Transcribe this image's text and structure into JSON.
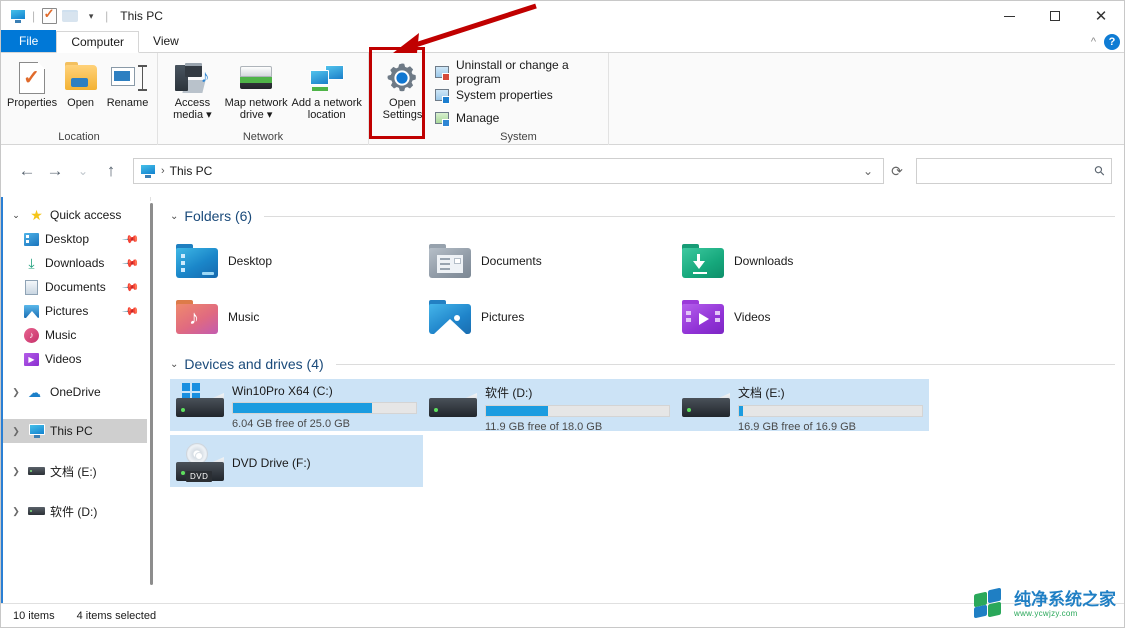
{
  "window": {
    "title": "This PC",
    "quick_access_toolbar": [
      {
        "name": "this-pc-icon",
        "label": "This PC"
      },
      {
        "name": "properties-icon",
        "label": "Properties"
      },
      {
        "name": "new-folder-icon",
        "label": "New folder"
      },
      {
        "name": "customize-caret-icon",
        "label": "Customize Quick Access Toolbar"
      }
    ],
    "controls": {
      "minimize": "—",
      "maximize": "□",
      "close": "✕"
    }
  },
  "tabs": [
    {
      "label": "File",
      "state": "file"
    },
    {
      "label": "Computer",
      "state": "active"
    },
    {
      "label": "View",
      "state": "normal"
    }
  ],
  "ribbon": {
    "collapse_label": "^",
    "help_label": "?",
    "groups": [
      {
        "name": "Location",
        "buttons": [
          {
            "label": "Properties",
            "icon": "properties-icon",
            "split": false
          },
          {
            "label": "Open",
            "icon": "open-folder-icon",
            "split": false
          },
          {
            "label": "Rename",
            "icon": "rename-icon",
            "split": false
          }
        ]
      },
      {
        "name": "Network",
        "buttons": [
          {
            "label": "Access media",
            "icon": "access-media-icon",
            "split": true
          },
          {
            "label": "Map network drive",
            "icon": "map-network-drive-icon",
            "split": true
          },
          {
            "label": "Add a network location",
            "icon": "add-network-location-icon",
            "split": false
          }
        ]
      },
      {
        "name": "System",
        "buttons": [
          {
            "label": "Open Settings",
            "icon": "settings-gear-icon",
            "split": false
          }
        ],
        "commands": [
          {
            "label": "Uninstall or change a program",
            "icon": "uninstall-program-icon"
          },
          {
            "label": "System properties",
            "icon": "system-properties-icon"
          },
          {
            "label": "Manage",
            "icon": "manage-icon"
          }
        ]
      }
    ],
    "highlight": {
      "target": "Open Settings",
      "color": "#c00000",
      "annotation": "red-arrow"
    }
  },
  "addressbar": {
    "back_label": "←",
    "forward_label": "→",
    "recent_label": "⌄",
    "up_label": "↑",
    "breadcrumbs": [
      "This PC"
    ],
    "separator": "›",
    "dropdown_label": "⌄",
    "refresh_label": "⟳",
    "search_value": "",
    "search_placeholder": "",
    "search_icon": "search-icon"
  },
  "navpane": {
    "items": [
      {
        "label": "Quick access",
        "icon": "star-icon",
        "chevron": "open",
        "indent": 0,
        "pinned": false,
        "selected": false
      },
      {
        "label": "Desktop",
        "icon": "desktop-icon",
        "chevron": "none",
        "indent": 1,
        "pinned": true,
        "selected": false
      },
      {
        "label": "Downloads",
        "icon": "downloads-icon",
        "chevron": "none",
        "indent": 1,
        "pinned": true,
        "selected": false
      },
      {
        "label": "Documents",
        "icon": "documents-icon",
        "chevron": "none",
        "indent": 1,
        "pinned": true,
        "selected": false
      },
      {
        "label": "Pictures",
        "icon": "pictures-icon",
        "chevron": "none",
        "indent": 1,
        "pinned": true,
        "selected": false
      },
      {
        "label": "Music",
        "icon": "music-icon",
        "chevron": "none",
        "indent": 1,
        "pinned": false,
        "selected": false
      },
      {
        "label": "Videos",
        "icon": "videos-icon",
        "chevron": "none",
        "indent": 1,
        "pinned": false,
        "selected": false
      },
      {
        "label": "OneDrive",
        "icon": "onedrive-icon",
        "chevron": "closed",
        "indent": 0,
        "pinned": false,
        "selected": false
      },
      {
        "label": "This PC",
        "icon": "this-pc-icon",
        "chevron": "closed",
        "indent": 0,
        "pinned": false,
        "selected": true
      },
      {
        "label": "文档 (E:)",
        "icon": "drive-icon",
        "chevron": "closed",
        "indent": 0,
        "pinned": false,
        "selected": false
      },
      {
        "label": "软件 (D:)",
        "icon": "drive-icon",
        "chevron": "closed",
        "indent": 0,
        "pinned": false,
        "selected": false
      }
    ]
  },
  "content": {
    "folders_group": {
      "title": "Folders (6)",
      "chevron": "⌄",
      "items": [
        {
          "label": "Desktop",
          "icon": "folder-desktop-icon"
        },
        {
          "label": "Documents",
          "icon": "folder-documents-icon"
        },
        {
          "label": "Downloads",
          "icon": "folder-downloads-icon"
        },
        {
          "label": "Music",
          "icon": "folder-music-icon"
        },
        {
          "label": "Pictures",
          "icon": "folder-pictures-icon"
        },
        {
          "label": "Videos",
          "icon": "folder-videos-icon"
        }
      ]
    },
    "devices_group": {
      "title": "Devices and drives (4)",
      "chevron": "⌄",
      "items": [
        {
          "label": "Win10Pro X64 (C:)",
          "icon": "windows-drive-icon",
          "free_text": "6.04 GB free of 25.0 GB",
          "free_gb": 6.04,
          "total_gb": 25.0,
          "used_percent": 76,
          "selected": true,
          "has_bar": true
        },
        {
          "label": "软件 (D:)",
          "icon": "drive-icon",
          "free_text": "11.9 GB free of 18.0 GB",
          "free_gb": 11.9,
          "total_gb": 18.0,
          "used_percent": 34,
          "selected": true,
          "has_bar": true
        },
        {
          "label": "文档 (E:)",
          "icon": "drive-icon",
          "free_text": "16.9 GB free of 16.9 GB",
          "free_gb": 16.9,
          "total_gb": 16.9,
          "used_percent": 2,
          "selected": true,
          "has_bar": true
        },
        {
          "label": "DVD Drive (F:)",
          "icon": "dvd-drive-icon",
          "free_text": "",
          "badge": "DVD",
          "selected": true,
          "has_bar": false
        }
      ]
    }
  },
  "statusbar": {
    "item_count": "10 items",
    "selection": "4 items selected"
  },
  "watermark": {
    "name": "纯净系统之家",
    "url": "www.ycwjzy.com"
  },
  "colors": {
    "accent": "#0078d7",
    "selection": "#cce3f6",
    "bar_fill": "#1b9ce0",
    "highlight_red": "#c00000",
    "group_title": "#1a4a7a"
  }
}
